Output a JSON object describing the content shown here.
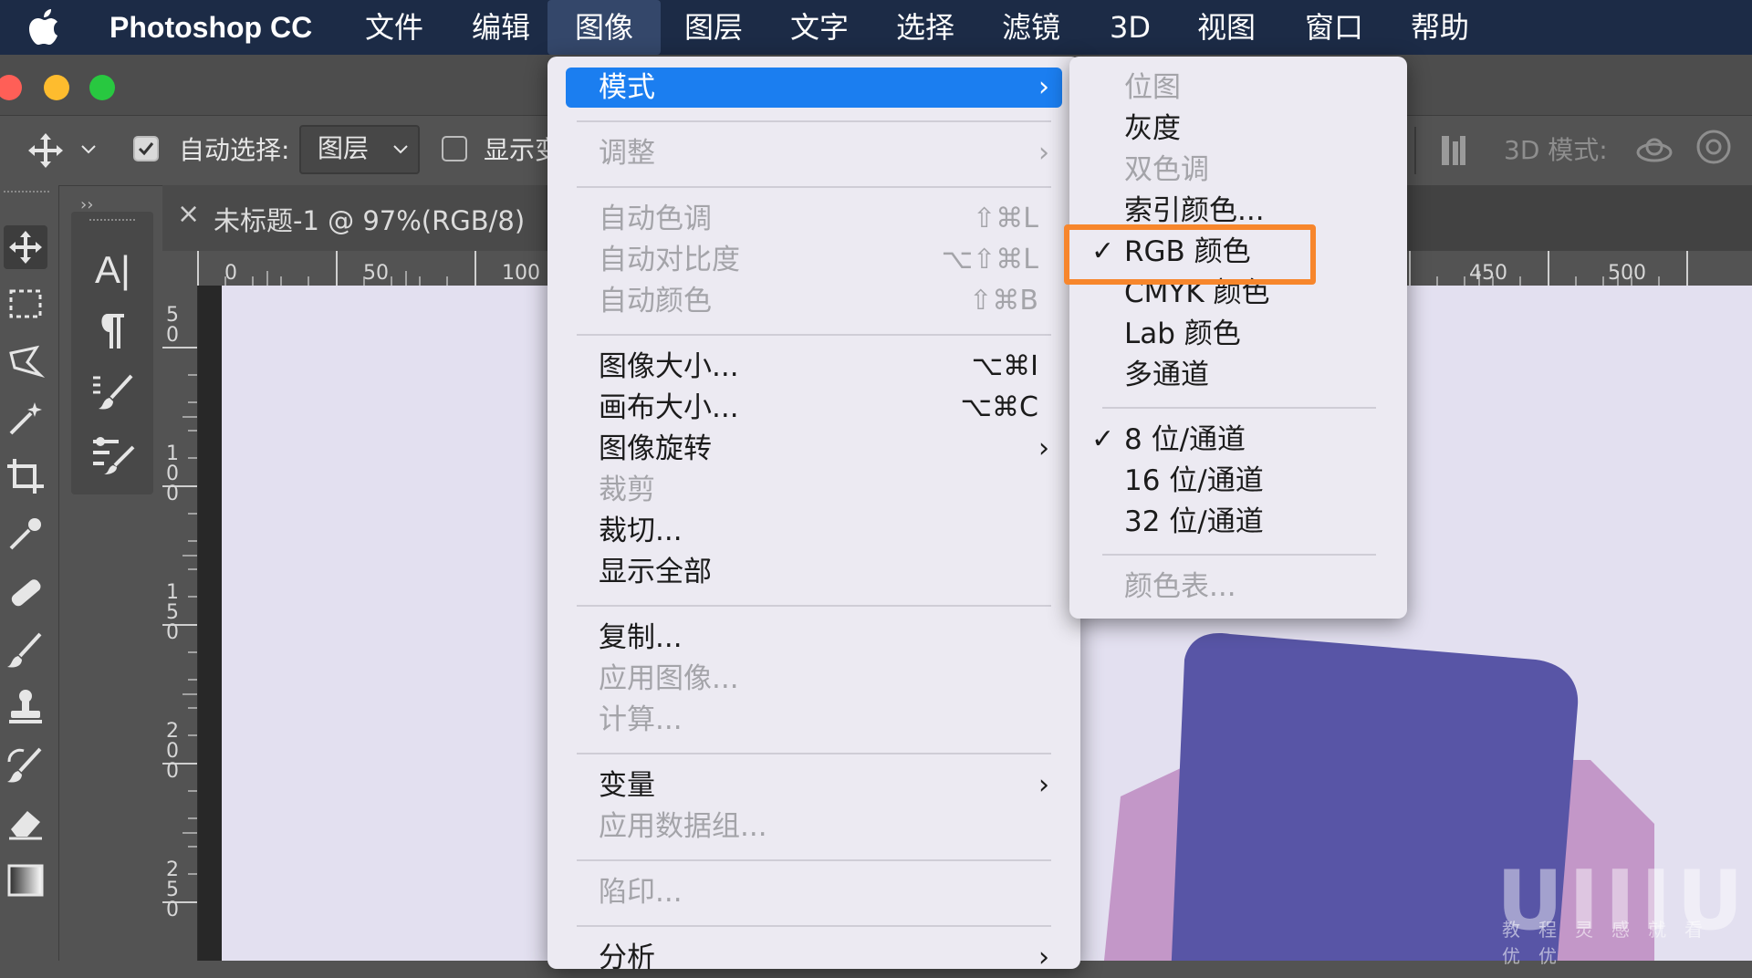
{
  "menubar": {
    "app_name": "Photoshop CC",
    "items": [
      "文件",
      "编辑",
      "图像",
      "图层",
      "文字",
      "选择",
      "滤镜",
      "3D",
      "视图",
      "窗口",
      "帮助"
    ],
    "active_item": "图像"
  },
  "options_bar": {
    "auto_select_label": "自动选择:",
    "auto_select_value": "图层",
    "show_transform_label": "显示变",
    "mode_3d_label": "3D 模式:"
  },
  "document_tab": {
    "title": "未标题-1 @ 97%(RGB/8)",
    "close_glyph": "×"
  },
  "rulers": {
    "top": [
      "0",
      "50",
      "100",
      "450",
      "500"
    ],
    "left": [
      "50",
      "100",
      "150",
      "200",
      "250"
    ]
  },
  "image_menu": {
    "mode": "模式",
    "adjustments": "调整",
    "auto_tone": "自动色调",
    "auto_tone_sc": "⇧⌘L",
    "auto_contrast": "自动对比度",
    "auto_contrast_sc": "⌥⇧⌘L",
    "auto_color": "自动颜色",
    "auto_color_sc": "⇧⌘B",
    "image_size": "图像大小...",
    "image_size_sc": "⌥⌘I",
    "canvas_size": "画布大小...",
    "canvas_size_sc": "⌥⌘C",
    "image_rotation": "图像旋转",
    "crop": "裁剪",
    "trim": "裁切...",
    "reveal_all": "显示全部",
    "duplicate": "复制...",
    "apply_image": "应用图像...",
    "calculations": "计算...",
    "variables": "变量",
    "apply_data_set": "应用数据组...",
    "trap": "陷印...",
    "analysis": "分析",
    "arrow": "›"
  },
  "mode_submenu": {
    "bitmap": "位图",
    "grayscale": "灰度",
    "duotone": "双色调",
    "indexed": "索引颜色...",
    "rgb": "RGB 颜色",
    "cmyk": "CMYK 颜色",
    "lab": "Lab 颜色",
    "multichannel": "多通道",
    "bit8": "8 位/通道",
    "bit16": "16 位/通道",
    "bit32": "32 位/通道",
    "color_table": "颜色表...",
    "check": "✓"
  },
  "watermark": {
    "logo": "UIIIUIII",
    "tagline": "教程灵感就看优优"
  },
  "colors": {
    "menubar_bg": "#1c2b46",
    "menu_highlight": "#1b7ef0",
    "annotation_orange": "#f7862c",
    "shape_purple": "#5855a6",
    "shape_pink": "#c397c8"
  }
}
